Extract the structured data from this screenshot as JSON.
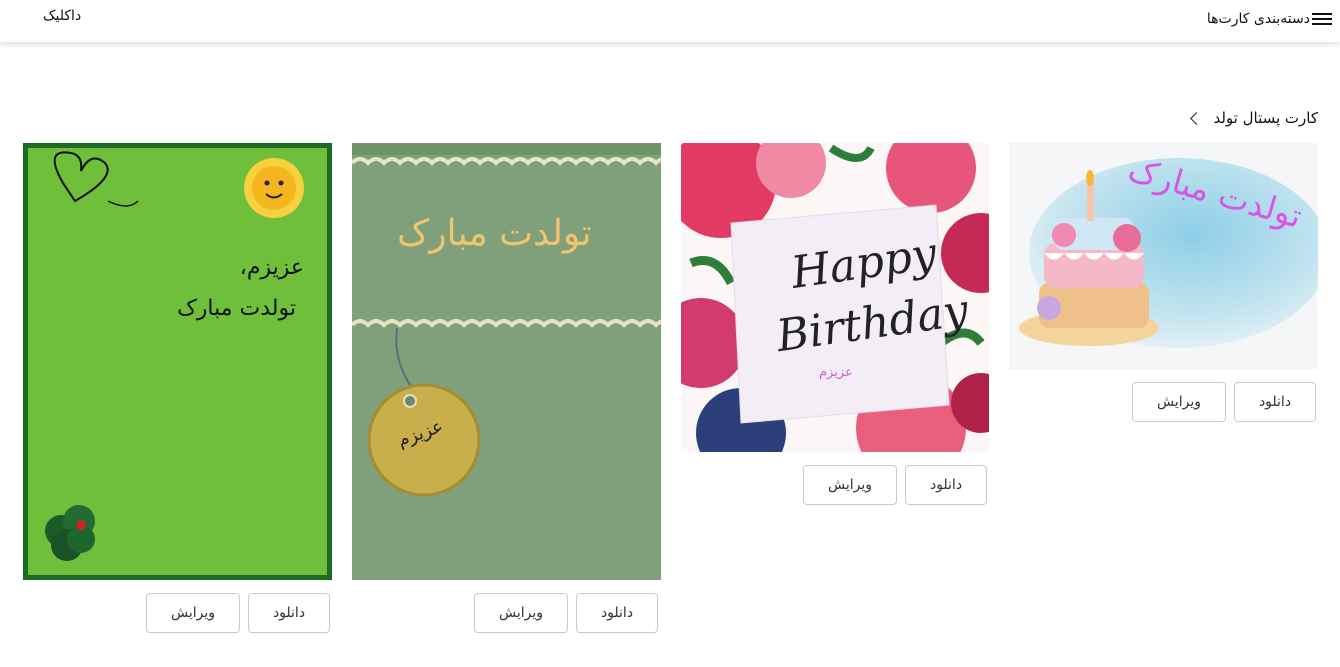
{
  "header": {
    "menu_label": "دسته‌بندی کارت‌ها",
    "logo": "داکلیک"
  },
  "breadcrumb": {
    "label": "کارت پستال تولد"
  },
  "cards": [
    {
      "greeting": "تولدت مبارک",
      "buttons": {
        "download": "دانلود",
        "edit": "ویرایش"
      }
    },
    {
      "greeting_en_1": "Happy",
      "greeting_en_2": "Birthday",
      "name": "عزیزم",
      "buttons": {
        "download": "دانلود",
        "edit": "ویرایش"
      }
    },
    {
      "greeting": "تولدت مبارک",
      "tag_name": "عزیزم",
      "buttons": {
        "download": "دانلود",
        "edit": "ویرایش"
      }
    },
    {
      "line1": "عزیزم،",
      "line2": "تولدت مبارک",
      "buttons": {
        "download": "دانلود",
        "edit": "ویرایش"
      }
    }
  ],
  "colors": {
    "accent_pink": "#d657e6",
    "gold": "#f2c46b",
    "green_card": "#6fbf3a",
    "sage_card": "#7fa07a"
  }
}
